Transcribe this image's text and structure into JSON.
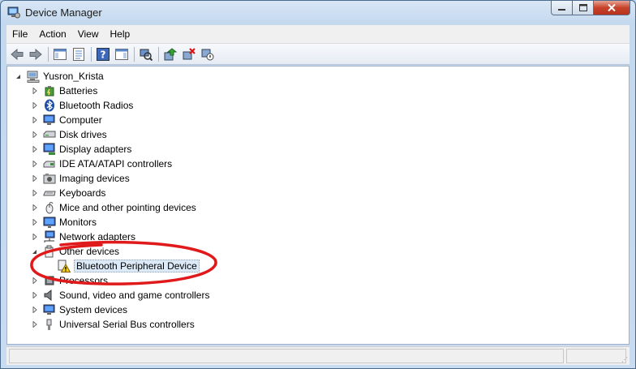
{
  "window": {
    "title": "Device Manager"
  },
  "caption_buttons": {
    "minimize_icon": "minimize-icon",
    "maximize_icon": "maximize-icon",
    "close_icon": "close-icon"
  },
  "menu": [
    "File",
    "Action",
    "View",
    "Help"
  ],
  "toolbar": [
    "back-icon",
    "forward-icon",
    "show-hide-console-tree-icon",
    "properties-icon",
    "help-icon",
    "action-pane-icon",
    "scan-hardware-icon",
    "update-driver-icon",
    "uninstall-icon",
    "disable-device-icon"
  ],
  "tree": {
    "root": {
      "label": "Yusron_Krista",
      "expanded": true
    },
    "items": [
      {
        "label": "Batteries",
        "icon": "battery-icon",
        "expanded": false
      },
      {
        "label": "Bluetooth Radios",
        "icon": "bluetooth-icon",
        "expanded": false
      },
      {
        "label": "Computer",
        "icon": "computer-icon",
        "expanded": false
      },
      {
        "label": "Disk drives",
        "icon": "disk-drive-icon",
        "expanded": false
      },
      {
        "label": "Display adapters",
        "icon": "display-adapter-icon",
        "expanded": false
      },
      {
        "label": "IDE ATA/ATAPI controllers",
        "icon": "ide-controller-icon",
        "expanded": false
      },
      {
        "label": "Imaging devices",
        "icon": "camera-icon",
        "expanded": false
      },
      {
        "label": "Keyboards",
        "icon": "keyboard-icon",
        "expanded": false
      },
      {
        "label": "Mice and other pointing devices",
        "icon": "mouse-icon",
        "expanded": false
      },
      {
        "label": "Monitors",
        "icon": "monitor-icon",
        "expanded": false
      },
      {
        "label": "Network adapters",
        "icon": "network-adapter-icon",
        "expanded": false
      },
      {
        "label": "Other devices",
        "icon": "unknown-device-icon",
        "expanded": true,
        "children": [
          {
            "label": "Bluetooth Peripheral Device",
            "icon": "warning-device-icon",
            "selected": true
          }
        ]
      },
      {
        "label": "Processors",
        "icon": "processor-icon",
        "expanded": false
      },
      {
        "label": "Sound, video and game controllers",
        "icon": "speaker-icon",
        "expanded": false
      },
      {
        "label": "System devices",
        "icon": "system-devices-icon",
        "expanded": false
      },
      {
        "label": "Universal Serial Bus controllers",
        "icon": "usb-icon",
        "expanded": false
      }
    ]
  },
  "annotation": {
    "color": "#e0191b"
  }
}
